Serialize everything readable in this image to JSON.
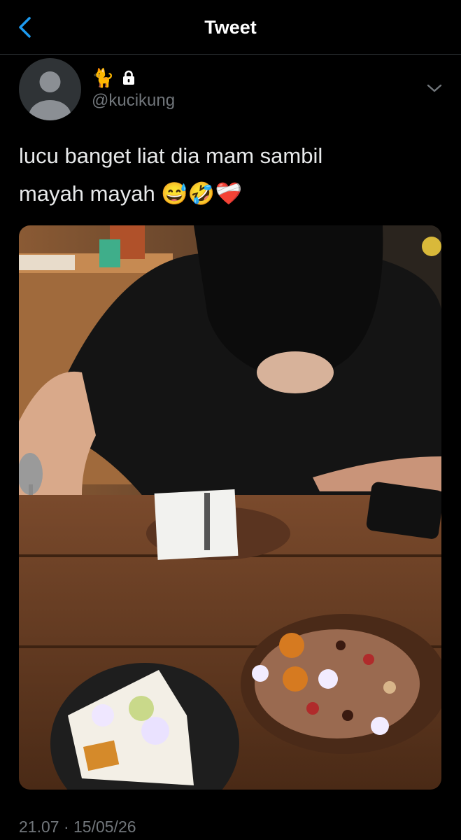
{
  "header": {
    "title": "Tweet"
  },
  "author": {
    "display_name": "🐈",
    "locked": true,
    "handle": "@kucikung"
  },
  "tweet": {
    "text_line1": "lucu banget liat dia mam sambil",
    "text_line2": "mayah mayah 😅🤣❤️‍🩹",
    "timestamp": "21.07 · 15/05/26"
  },
  "icons": {
    "back": "chevron-left-icon",
    "lock": "lock-icon",
    "more": "chevron-down-icon"
  },
  "colors": {
    "background": "#000000",
    "accent": "#1d9bf0",
    "muted": "#71767b",
    "divider": "#2f3336"
  }
}
